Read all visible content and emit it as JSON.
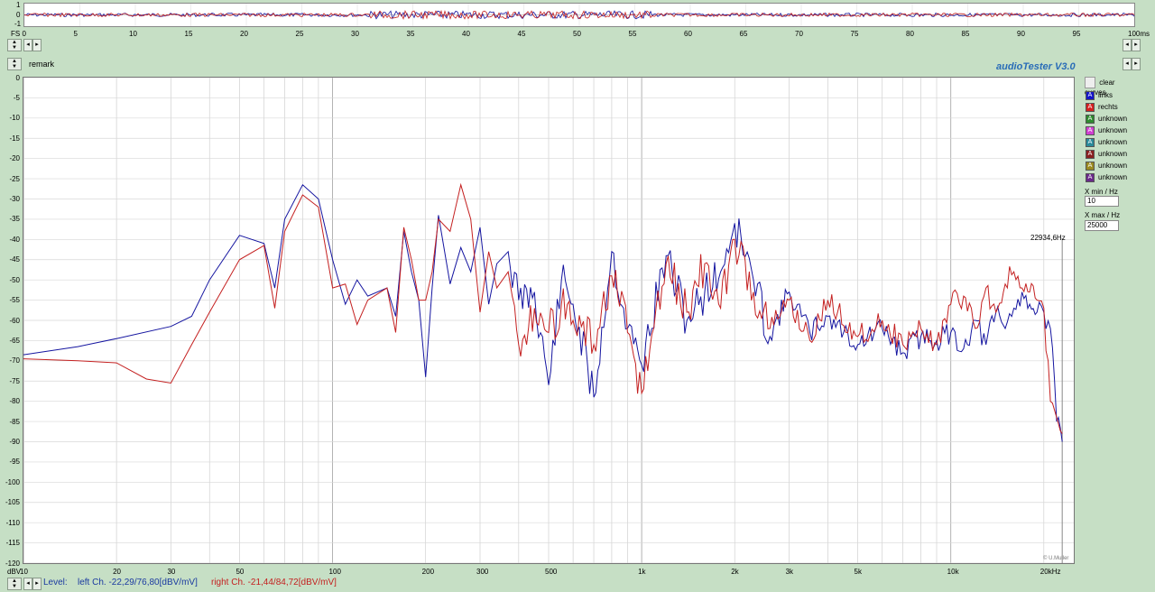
{
  "app": {
    "title": "audioTester  V3.0",
    "remark_label": "remark",
    "copyright": "© U.Muller"
  },
  "waveform": {
    "y_labels": [
      "1",
      "0",
      "-1"
    ],
    "x_ticks": [
      "FS 0",
      "5",
      "10",
      "15",
      "20",
      "25",
      "30",
      "35",
      "40",
      "45",
      "50",
      "55",
      "60",
      "65",
      "70",
      "75",
      "80",
      "85",
      "90",
      "95",
      "100ms"
    ]
  },
  "legend": {
    "clear_label": "clear curves",
    "items": [
      {
        "letter": "A",
        "color": "#1515c8",
        "label": "links"
      },
      {
        "letter": "A",
        "color": "#d42020",
        "label": "rechts"
      },
      {
        "letter": "A",
        "color": "#2e8a2e",
        "label": "unknown"
      },
      {
        "letter": "A",
        "color": "#d040d0",
        "label": "unknown"
      },
      {
        "letter": "A",
        "color": "#2a8a9a",
        "label": "unknown"
      },
      {
        "letter": "A",
        "color": "#8a2020",
        "label": "unknown"
      },
      {
        "letter": "A",
        "color": "#9a8a20",
        "label": "unknown"
      },
      {
        "letter": "A",
        "color": "#6a2a8a",
        "label": "unknown"
      }
    ]
  },
  "xrange": {
    "min_label": "X min / Hz",
    "min_value": "10",
    "max_label": "X max / Hz",
    "max_value": "25000"
  },
  "marker": {
    "label": "22934,6Hz",
    "freq": 22934.6
  },
  "status": {
    "level_label": "Level:",
    "left": "left Ch. -22,29/76,80[dBV/mV]",
    "right": "right Ch. -21,44/84,72[dBV/mV]"
  },
  "chart_data": {
    "type": "line",
    "xscale": "log",
    "xlim": [
      10,
      25000
    ],
    "ylim": [
      -120,
      0
    ],
    "ylabel": "dBV",
    "y_ticks": [
      0,
      -5,
      -10,
      -15,
      -20,
      -25,
      -30,
      -35,
      -40,
      -45,
      -50,
      -55,
      -60,
      -65,
      -70,
      -75,
      -80,
      -85,
      -90,
      -95,
      -100,
      -105,
      -110,
      -115,
      -120
    ],
    "x_tick_labels": [
      {
        "v": 10,
        "t": "10"
      },
      {
        "v": 20,
        "t": "20"
      },
      {
        "v": 30,
        "t": "30"
      },
      {
        "v": 50,
        "t": "50"
      },
      {
        "v": 100,
        "t": "100"
      },
      {
        "v": 200,
        "t": "200"
      },
      {
        "v": 300,
        "t": "300"
      },
      {
        "v": 500,
        "t": "500"
      },
      {
        "v": 1000,
        "t": "1k"
      },
      {
        "v": 2000,
        "t": "2k"
      },
      {
        "v": 3000,
        "t": "3k"
      },
      {
        "v": 5000,
        "t": "5k"
      },
      {
        "v": 10000,
        "t": "10k"
      },
      {
        "v": 20000,
        "t": "20kHz"
      }
    ],
    "series": [
      {
        "name": "links",
        "color": "#1515a0",
        "x": [
          10,
          15,
          20,
          30,
          35,
          40,
          50,
          60,
          65,
          70,
          80,
          90,
          100,
          110,
          120,
          130,
          150,
          160,
          170,
          180,
          190,
          200,
          210,
          220,
          240,
          260,
          280,
          300,
          320,
          340,
          370,
          400,
          450,
          500,
          550,
          600,
          700,
          800,
          900,
          1000,
          1200,
          1400,
          1600,
          1800,
          2000,
          2300,
          2600,
          3000,
          3500,
          4000,
          5000,
          6000,
          7000,
          8000,
          9000,
          10000,
          11000,
          12000,
          13000,
          14000,
          15000,
          16000,
          17000,
          18000,
          19000,
          20000,
          21000,
          22000,
          22934
        ],
        "y": [
          -68.5,
          -66.5,
          -64.5,
          -61.5,
          -59,
          -50,
          -39,
          -41,
          -52,
          -35,
          -26.5,
          -30,
          -45,
          -56,
          -50,
          -54,
          -52,
          -59,
          -38,
          -48,
          -55,
          -74,
          -52,
          -34,
          -51,
          -42,
          -48,
          -37,
          -56,
          -46,
          -43,
          -55,
          -53,
          -76,
          -50,
          -56,
          -79,
          -43,
          -62,
          -71,
          -44,
          -60,
          -53,
          -48,
          -36,
          -50,
          -64,
          -53,
          -63,
          -59,
          -66,
          -62,
          -68,
          -64,
          -65,
          -63,
          -67,
          -60,
          -66,
          -58,
          -62,
          -57,
          -53,
          -56,
          -58,
          -58,
          -62,
          -85,
          -90
        ]
      },
      {
        "name": "rechts",
        "color": "#c42020",
        "x": [
          10,
          15,
          20,
          25,
          30,
          35,
          40,
          50,
          60,
          65,
          70,
          80,
          90,
          100,
          110,
          120,
          130,
          150,
          160,
          170,
          180,
          190,
          200,
          210,
          220,
          240,
          260,
          280,
          300,
          320,
          340,
          370,
          400,
          450,
          500,
          550,
          600,
          700,
          800,
          900,
          1000,
          1200,
          1400,
          1600,
          1800,
          2000,
          2300,
          2600,
          3000,
          3500,
          4000,
          5000,
          6000,
          7000,
          8000,
          9000,
          10000,
          11000,
          12000,
          13000,
          14000,
          15000,
          16000,
          17000,
          18000,
          19000,
          20000,
          21000,
          22000,
          22934
        ],
        "y": [
          -69.5,
          -70,
          -70.5,
          -74.5,
          -75.5,
          -66,
          -58,
          -45,
          -41.5,
          -57,
          -38,
          -29,
          -32,
          -52,
          -51,
          -61,
          -55,
          -52,
          -63,
          -37,
          -45,
          -55,
          -55,
          -48,
          -35,
          -38,
          -26.5,
          -35,
          -58,
          -43,
          -52,
          -48,
          -66,
          -57,
          -63,
          -56,
          -60,
          -66,
          -49,
          -63,
          -78,
          -46,
          -58,
          -46,
          -57,
          -40,
          -53,
          -62,
          -55,
          -65,
          -55,
          -64,
          -60,
          -66,
          -62,
          -66,
          -56,
          -54,
          -62,
          -52,
          -58,
          -51,
          -48,
          -52,
          -53,
          -55,
          -57,
          -80,
          -84,
          -88
        ]
      }
    ]
  }
}
